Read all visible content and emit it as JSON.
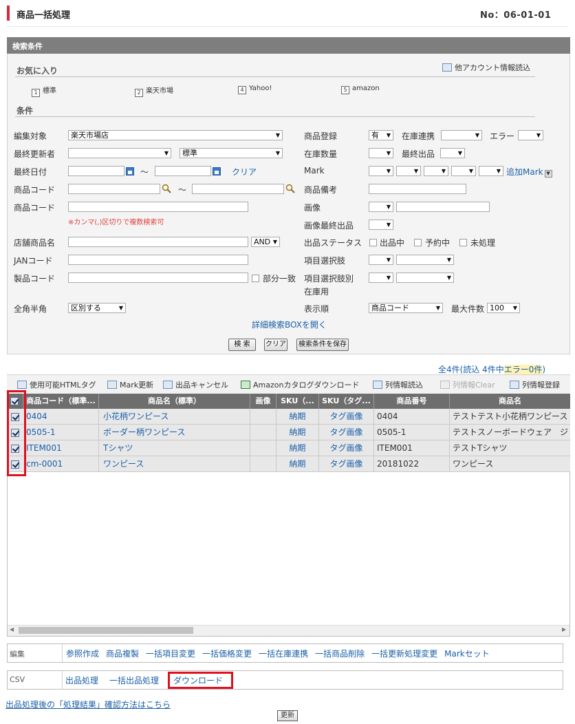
{
  "header": {
    "title": "商品一括処理",
    "page_no": "No：06-01-01"
  },
  "search_panel": {
    "title": "検索条件",
    "favorites_title": "お気に入り",
    "other_account_link": "他アカウント情報読込",
    "favorites": [
      {
        "num": "1",
        "label": "標準"
      },
      {
        "num": "2",
        "label": "楽天市場"
      },
      {
        "num": "4",
        "label": "Yahoo!"
      },
      {
        "num": "5",
        "label": "amazon"
      }
    ],
    "conditions_title": "条件",
    "left": {
      "edit_target_label": "編集対象",
      "edit_target_value": "楽天市場店",
      "last_updater_label": "最終更新者",
      "last_updater_value": "",
      "standard_value": "標準",
      "last_date_label": "最終日付",
      "tilde": "～",
      "clear_link": "クリア",
      "product_code_label": "商品コード",
      "product_code2_label": "商品コード",
      "comma_note": "※カンマ(,)区切りで複数検索可",
      "shop_product_name_label": "店舗商品名",
      "and_value": "AND",
      "jan_label": "JANコード",
      "product_code3_label": "製品コード",
      "partial_match_label": "部分一致",
      "zenkaku_label": "全角半角",
      "zenkaku_value": "区別する"
    },
    "right": {
      "product_reg_label": "商品登録",
      "product_reg_value": "有",
      "stock_link_label": "在庫連携",
      "error_label": "エラー",
      "stock_qty_label": "在庫数量",
      "last_listing_label": "最終出品",
      "mark_label": "Mark",
      "add_mark_link": "追加Mark",
      "product_note_label": "商品備考",
      "image_label": "画像",
      "image_last_label": "画像最終出品",
      "listing_status_label": "出品ステータス",
      "status_options": [
        "出品中",
        "予約中",
        "未処理"
      ],
      "item_option_label": "項目選択肢",
      "item_option_stock_label_1": "項目選択肢別",
      "item_option_stock_label_2": "在庫用",
      "order_label": "表示順",
      "order_value": "商品コード",
      "max_count_label": "最大件数",
      "max_count_value": "100"
    },
    "detail_link": "詳細検索BOXを開く",
    "buttons": {
      "search": "検 索",
      "clear": "クリア",
      "save": "検索条件を保存"
    }
  },
  "results": {
    "count_prefix": "全4件(読込 4件中",
    "count_error": "エラー0件",
    "count_suffix": ")",
    "toolbar": [
      {
        "label": "使用可能HTMLタグ",
        "icon": "html-icon",
        "disabled": false
      },
      {
        "label": "Mark更新",
        "icon": "mark-edit-icon",
        "disabled": false
      },
      {
        "label": "出品キャンセル",
        "icon": "cancel-listing-icon",
        "disabled": false
      },
      {
        "label": "Amazonカタログダウンロード",
        "icon": "excel-icon",
        "disabled": false
      },
      {
        "label": "列情報読込",
        "icon": "column-load-icon",
        "disabled": false
      },
      {
        "label": "列情報Clear",
        "icon": "column-clear-icon",
        "disabled": true
      },
      {
        "label": "列情報登録",
        "icon": "column-save-icon",
        "disabled": false
      }
    ],
    "columns": [
      "商品コード（標準...",
      "商品名（標準）",
      "画像",
      "SKU（...",
      "SKU（タグ...",
      "商品番号",
      "商品名"
    ],
    "rows": [
      {
        "code": "0404",
        "name": "小花柄ワンピース",
        "sku1": "納期",
        "sku2": "タグ画像",
        "number": "0404",
        "pname": "テストテスト小花柄ワンピース"
      },
      {
        "code": "0505-1",
        "name": "ボーダー柄ワンピース",
        "sku1": "納期",
        "sku2": "タグ画像",
        "number": "0505-1",
        "pname": "テストスノーボードウェア　ジ"
      },
      {
        "code": "ITEM001",
        "name": "Tシャツ",
        "sku1": "納期",
        "sku2": "タグ画像",
        "number": "ITEM001",
        "pname": "テストTシャツ"
      },
      {
        "code": "cm-0001",
        "name": "ワンピース",
        "sku1": "納期",
        "sku2": "タグ画像",
        "number": "20181022",
        "pname": "ワンピース"
      }
    ]
  },
  "actions": {
    "edit_label": "編集",
    "edit_items": [
      "参照作成",
      "商品複製",
      "一括項目変更",
      "一括価格変更",
      "一括在庫連携",
      "一括商品削除",
      "一括更新処理変更",
      "Markセット"
    ],
    "csv_label": "CSV",
    "csv_items": [
      "出品処理",
      "一括出品処理",
      "ダウンロード"
    ]
  },
  "footer": {
    "result_link": "出品処理後の「処理結果」確認方法はこちら",
    "update_button": "更新"
  }
}
